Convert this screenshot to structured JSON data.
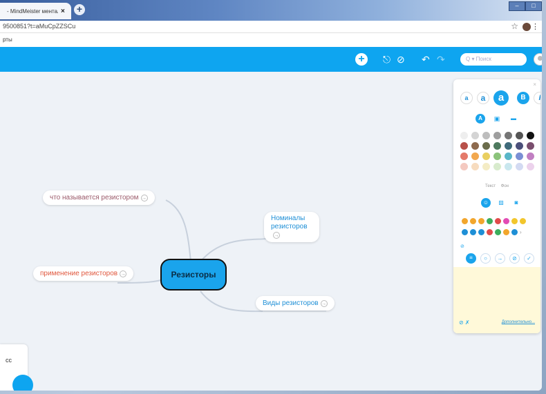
{
  "browser": {
    "tab_title": "- MindMeister ментал",
    "tab_close": "×",
    "new_tab": "+",
    "url": "9500851?t=aMuCpZZSCu",
    "bookmarks_text": "рты",
    "window_buttons": [
      "–",
      "□"
    ]
  },
  "toolbar": {
    "add_label": "+",
    "search_placeholder": "Q ▾ Поиск",
    "undo": "↶",
    "redo": "↷",
    "share": "⎋",
    "block": "⊘"
  },
  "mindmap": {
    "central": "Резисторы",
    "nodes": {
      "what": "что называется резистором",
      "apply": "применение резисторов",
      "nominal": "Номиналы резисторов",
      "types": "Виды резисторов"
    },
    "node_arrow": "→"
  },
  "chat_card": {
    "text": "сс"
  },
  "panel": {
    "close": "×",
    "font_sizes": [
      "a",
      "a",
      "a"
    ],
    "bold": "B",
    "italic": "I",
    "style_text": "A",
    "palette": [
      "#eeeeee",
      "#d4d4d4",
      "#bdbdbd",
      "#9e9e9e",
      "#757575",
      "#555555",
      "#111111",
      "#b8514a",
      "#8e6b4e",
      "#6b6d4c",
      "#4e7a5e",
      "#3f6a7a",
      "#4b4f7a",
      "#7a4e6e",
      "#e47a6a",
      "#f2a84f",
      "#e9cf60",
      "#8bc37a",
      "#59b6c8",
      "#7a8fd4",
      "#c17fc2",
      "#f4c9c0",
      "#f7dcbf",
      "#f4ecc5",
      "#d8ebcd",
      "#c9e7ee",
      "#d3daf2",
      "#ecd2ec"
    ],
    "label_text": "Текст",
    "label_bg": "Фон",
    "emoji_row1_colors": [
      "#f2a62c",
      "#f2a62c",
      "#f2a62c",
      "#3cae5c",
      "#e24b4b",
      "#e24bb4",
      "#f2c62c",
      "#f2c62c"
    ],
    "emoji_row2_colors": [
      "#1e8fd6",
      "#1e8fd6",
      "#1e8fd6",
      "#e24b4b",
      "#3cae5c",
      "#f2a62c",
      "#1e8fd6"
    ],
    "emoji_more": "›",
    "footer_more": "Дополнительно..."
  }
}
